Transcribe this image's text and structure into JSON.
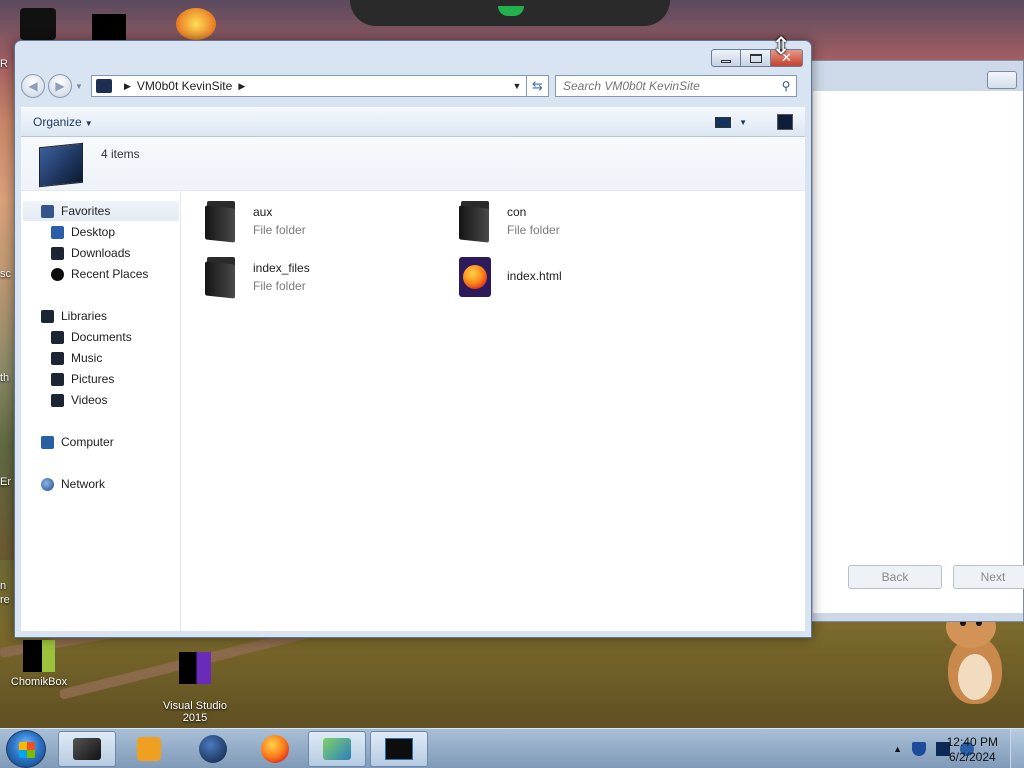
{
  "desktop": {
    "icons": [
      {
        "label": "ChomikBox"
      },
      {
        "label": "Visual Studio\n2015"
      }
    ],
    "edge_labels": [
      "R",
      "sc",
      "th",
      "Er",
      "n",
      "re"
    ]
  },
  "background_window": {
    "back_label": "Back",
    "next_label": "Next"
  },
  "explorer": {
    "address": {
      "segments": [
        "VM0b0t KevinSite"
      ]
    },
    "search": {
      "placeholder": "Search VM0b0t KevinSite"
    },
    "toolbar": {
      "organize_label": "Organize"
    },
    "details": {
      "item_count": "4 items"
    },
    "nav": {
      "favorites": "Favorites",
      "favorites_items": [
        "Desktop",
        "Downloads",
        "Recent Places"
      ],
      "libraries": "Libraries",
      "libraries_items": [
        "Documents",
        "Music",
        "Pictures",
        "Videos"
      ],
      "computer": "Computer",
      "network": "Network"
    },
    "files": [
      {
        "name": "aux",
        "type": "File folder",
        "icon": "folder-icon"
      },
      {
        "name": "con",
        "type": "File folder",
        "icon": "folder-icon"
      },
      {
        "name": "index_files",
        "type": "File folder",
        "icon": "folder-icon"
      },
      {
        "name": "index.html",
        "type": "",
        "icon": "firefox-html-icon"
      }
    ]
  },
  "taskbar": {
    "pinned": [
      "explorer-icon",
      "media-player-icon",
      "globe-icon",
      "firefox-icon",
      "chart-app-icon",
      "monitor-app-icon"
    ],
    "clock": {
      "time": "12:40 PM",
      "date": "6/2/2024"
    }
  },
  "colors": {
    "title_accent": "#d8e4f2",
    "close_button": "#c4402c",
    "taskbar": "#8fa8c4"
  }
}
